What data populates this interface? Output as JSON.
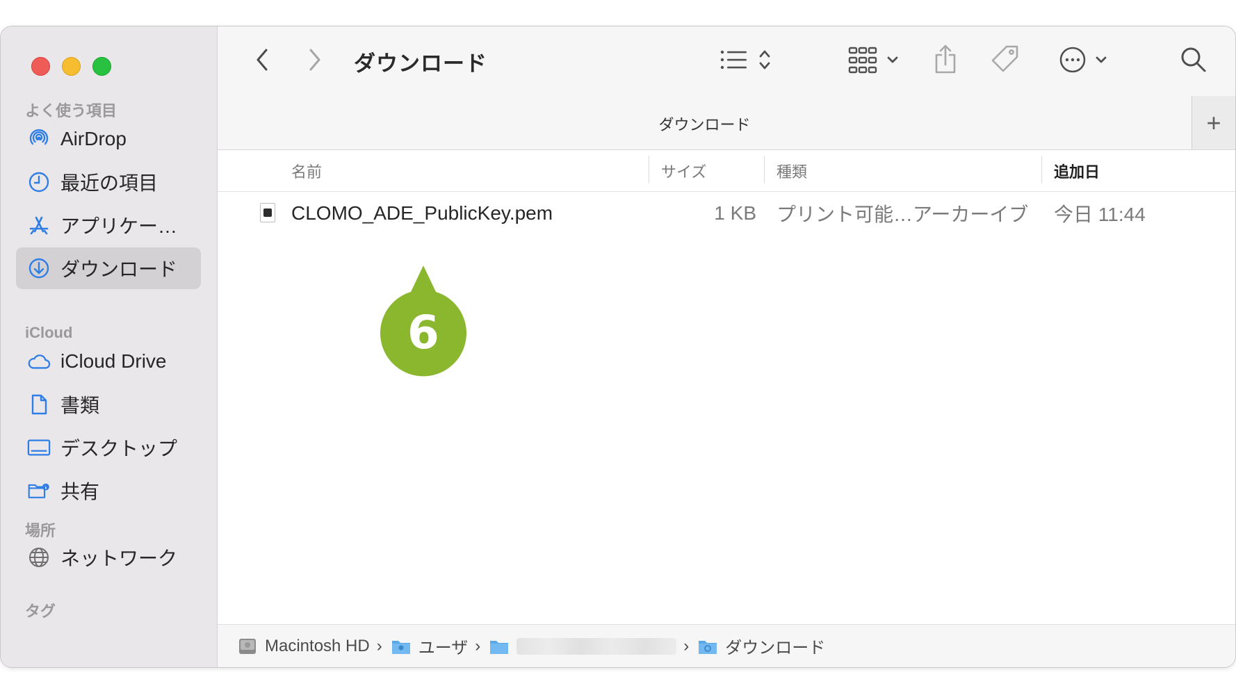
{
  "window": {
    "title": "ダウンロード"
  },
  "sidebar": {
    "sections": [
      {
        "header": "よく使う項目",
        "items": [
          {
            "label": "AirDrop",
            "icon": "airdrop-icon"
          },
          {
            "label": "最近の項目",
            "icon": "clock-icon"
          },
          {
            "label": "アプリケー…",
            "icon": "applications-icon"
          },
          {
            "label": "ダウンロード",
            "icon": "downloads-icon",
            "selected": true
          }
        ]
      },
      {
        "header": "iCloud",
        "items": [
          {
            "label": "iCloud Drive",
            "icon": "icloud-icon"
          },
          {
            "label": "書類",
            "icon": "document-icon"
          },
          {
            "label": "デスクトップ",
            "icon": "desktop-icon"
          },
          {
            "label": "共有",
            "icon": "shared-folder-icon"
          }
        ]
      },
      {
        "header": "場所",
        "items": [
          {
            "label": "ネットワーク",
            "icon": "network-icon"
          }
        ]
      },
      {
        "header": "タグ",
        "items": []
      }
    ]
  },
  "tabbar": {
    "title": "ダウンロード",
    "add_label": "+"
  },
  "columns": {
    "name": "名前",
    "size": "サイズ",
    "kind": "種類",
    "date_added": "追加日"
  },
  "files": [
    {
      "name": "CLOMO_ADE_PublicKey.pem",
      "size": "1 KB",
      "kind": "プリント可能…アーカーイブ",
      "date_added": "今日 11:44"
    }
  ],
  "callout": {
    "number": "6",
    "color": "#8ab72e"
  },
  "pathbar": {
    "segments": [
      {
        "label": "Macintosh HD",
        "icon": "hard-drive-icon"
      },
      {
        "label": "ユーザ",
        "icon": "users-folder-icon"
      },
      {
        "label": "",
        "icon": "home-folder-icon",
        "redacted": true
      },
      {
        "label": "ダウンロード",
        "icon": "downloads-folder-icon"
      }
    ],
    "separator": "›"
  },
  "colors": {
    "accent": "#2f7ee6",
    "sidebar_bg": "#e9e7ea",
    "selected_bg": "#d3d1d4"
  }
}
